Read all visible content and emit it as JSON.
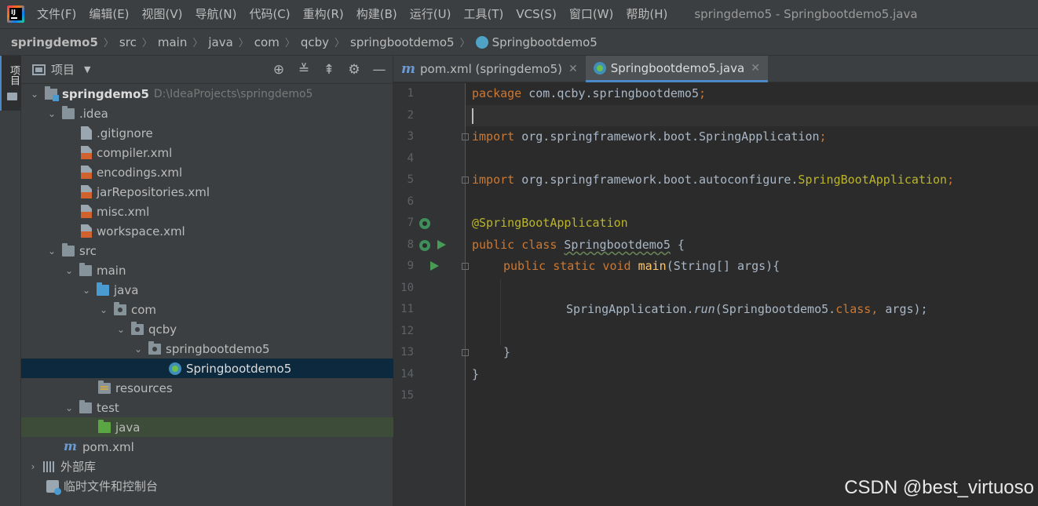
{
  "menubar": {
    "items": [
      "文件(F)",
      "编辑(E)",
      "视图(V)",
      "导航(N)",
      "代码(C)",
      "重构(R)",
      "构建(B)",
      "运行(U)",
      "工具(T)",
      "VCS(S)",
      "窗口(W)",
      "帮助(H)"
    ],
    "window_title": "springdemo5 - Springbootdemo5.java"
  },
  "breadcrumb": {
    "items": [
      "springdemo5",
      "src",
      "main",
      "java",
      "com",
      "qcby",
      "springbootdemo5",
      "Springbootdemo5"
    ]
  },
  "stripe": {
    "project_tab_label": "项目"
  },
  "project_panel": {
    "title": "项目",
    "tree": [
      {
        "label": "springdemo5",
        "hint": "D:\\IdeaProjects\\springdemo5"
      },
      {
        "label": ".idea"
      },
      {
        "label": ".gitignore"
      },
      {
        "label": "compiler.xml"
      },
      {
        "label": "encodings.xml"
      },
      {
        "label": "jarRepositories.xml"
      },
      {
        "label": "misc.xml"
      },
      {
        "label": "workspace.xml"
      },
      {
        "label": "src"
      },
      {
        "label": "main"
      },
      {
        "label": "java"
      },
      {
        "label": "com"
      },
      {
        "label": "qcby"
      },
      {
        "label": "springbootdemo5"
      },
      {
        "label": "Springbootdemo5"
      },
      {
        "label": "resources"
      },
      {
        "label": "test"
      },
      {
        "label": "java"
      },
      {
        "label": "pom.xml"
      },
      {
        "label": "外部库"
      },
      {
        "label": "临时文件和控制台"
      }
    ]
  },
  "editor": {
    "tabs": [
      {
        "label": "pom.xml (springdemo5)",
        "active": false
      },
      {
        "label": "Springbootdemo5.java",
        "active": true
      }
    ],
    "line_numbers": [
      "1",
      "2",
      "3",
      "4",
      "5",
      "6",
      "7",
      "8",
      "9",
      "10",
      "11",
      "12",
      "13",
      "14",
      "15"
    ],
    "code": {
      "l1_kw": "package",
      "l1_rest": " com.qcby.springbootdemo5",
      "l1_semi": ";",
      "l3_kw": "import",
      "l3_rest": " org.springframework.boot.SpringApplication",
      "l3_semi": ";",
      "l5_kw": "import",
      "l5_rest": " org.springframework.boot.autoconfigure.",
      "l5_cls": "SpringBootApplication",
      "l5_semi": ";",
      "l7_ann": "@SpringBootApplication",
      "l8_kw": "public class",
      "l8_name": "Springbootdemo5",
      "l8_rest": " {",
      "l9_kw": "public static void",
      "l9_fn": "main",
      "l9_rest": "(String[] args){",
      "l11_cls": "SpringApplication.",
      "l11_fn": "run",
      "l11_open": "(Springbootdemo5.",
      "l11_kw": "class",
      "l11_comma": ",",
      "l11_rest": " args);",
      "l13": "}",
      "l14": "}"
    }
  },
  "watermark": "CSDN @best_virtuoso",
  "colors": {
    "keyword": "#cc7832",
    "annotation": "#bbb529",
    "method": "#ffc66d",
    "text": "#a9b7c6",
    "selection": "#0d293e",
    "accent": "#4a88c7"
  }
}
